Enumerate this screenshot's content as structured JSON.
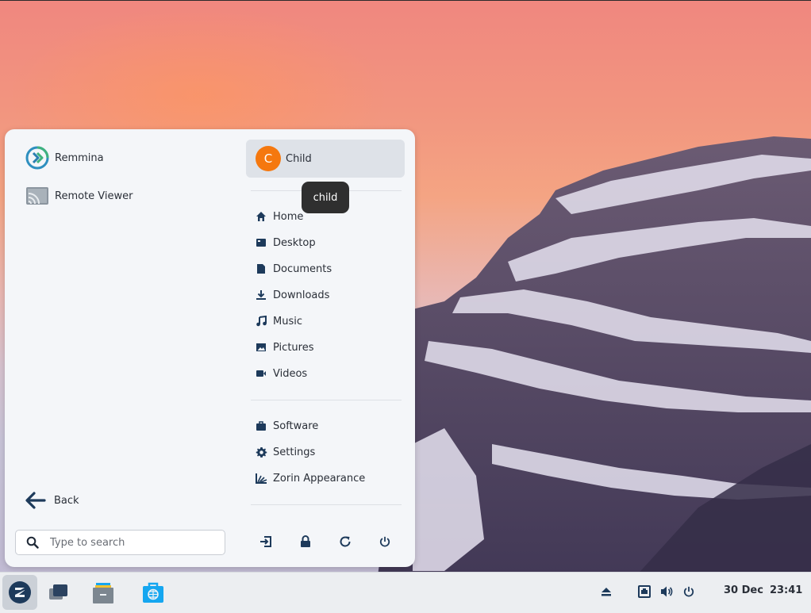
{
  "apps": [
    {
      "label": "Remmina",
      "icon": "remmina-icon"
    },
    {
      "label": "Remote Viewer",
      "icon": "remote-viewer-icon"
    }
  ],
  "back_label": "Back",
  "search": {
    "placeholder": "Type to search",
    "value": ""
  },
  "user": {
    "initial": "C",
    "name": "Child",
    "avatar_color": "#f5780f"
  },
  "tooltip": "child",
  "places": [
    {
      "label": "Home",
      "icon": "home-icon"
    },
    {
      "label": "Desktop",
      "icon": "desktop-folder-icon"
    },
    {
      "label": "Documents",
      "icon": "document-icon"
    },
    {
      "label": "Downloads",
      "icon": "download-icon"
    },
    {
      "label": "Music",
      "icon": "music-icon"
    },
    {
      "label": "Pictures",
      "icon": "picture-icon"
    },
    {
      "label": "Videos",
      "icon": "video-icon"
    }
  ],
  "system": [
    {
      "label": "Software",
      "icon": "software-icon"
    },
    {
      "label": "Settings",
      "icon": "gear-icon"
    },
    {
      "label": "Zorin Appearance",
      "icon": "appearance-icon"
    }
  ],
  "power_actions": [
    "logout-icon",
    "lock-icon",
    "restart-icon",
    "power-icon"
  ],
  "taskbar": {
    "apps": [
      "zorin-menu-icon",
      "workspaces-icon",
      "files-icon",
      "software-store-icon"
    ],
    "tray": [
      "eject-icon",
      "network-icon",
      "volume-icon",
      "power-icon"
    ],
    "date": "30 Dec",
    "time": "23:41"
  },
  "colors": {
    "accent": "#15a6f0",
    "icon_dark": "#1d3a5b",
    "avatar": "#f5780f"
  }
}
